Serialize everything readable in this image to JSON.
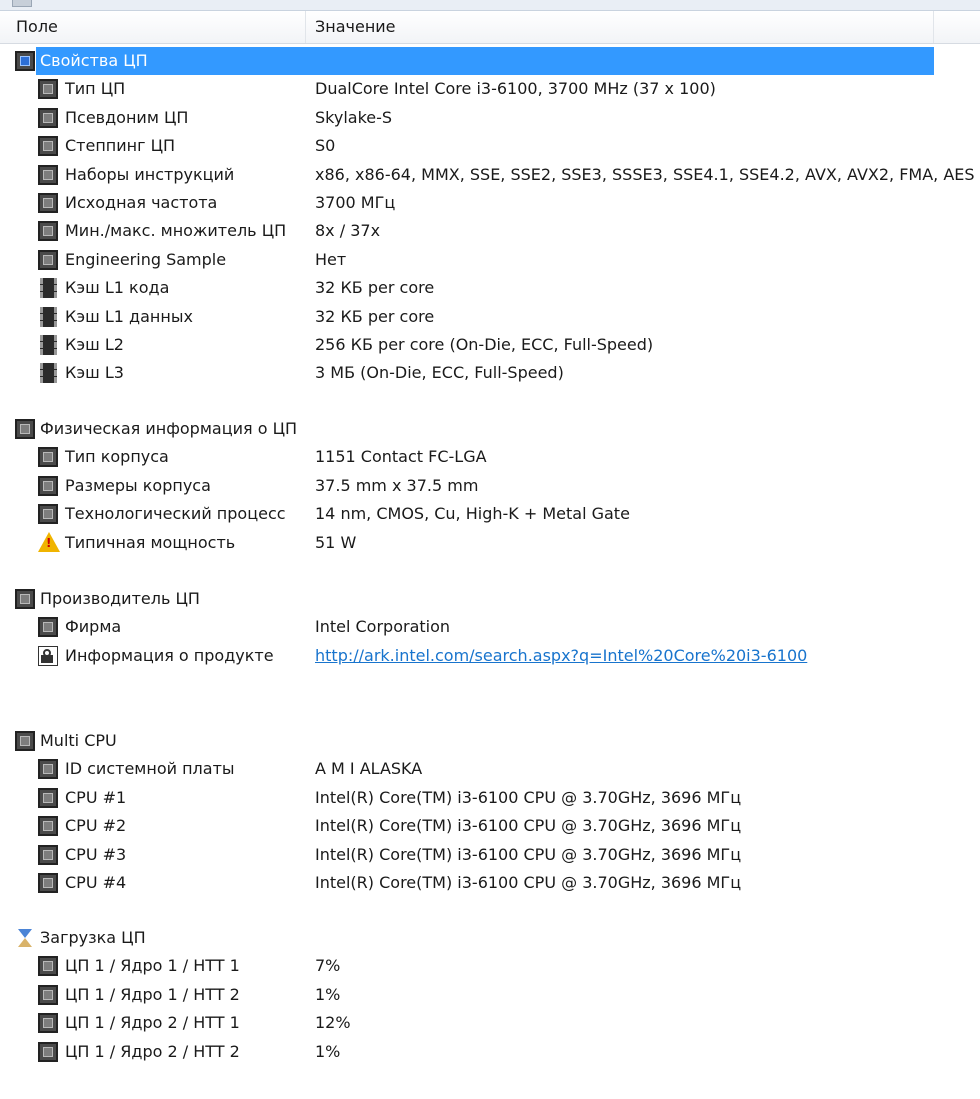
{
  "header": {
    "field": "Поле",
    "value": "Значение"
  },
  "sections": [
    {
      "title": "Свойства ЦП",
      "icon": "cpu-chip-icon",
      "selected": true,
      "items": [
        {
          "label": "Тип ЦП",
          "value": "DualCore Intel Core i3-6100, 3700 MHz (37 x 100)",
          "icon": "cpu-chip-icon"
        },
        {
          "label": "Псевдоним ЦП",
          "value": "Skylake-S",
          "icon": "cpu-chip-icon"
        },
        {
          "label": "Степпинг ЦП",
          "value": "S0",
          "icon": "cpu-chip-icon"
        },
        {
          "label": "Наборы инструкций",
          "value": "x86, x86-64, MMX, SSE, SSE2, SSE3, SSSE3, SSE4.1, SSE4.2, AVX, AVX2, FMA, AES",
          "icon": "cpu-chip-icon"
        },
        {
          "label": "Исходная частота",
          "value": "3700 МГц",
          "icon": "cpu-chip-icon"
        },
        {
          "label": "Мин./макс. множитель ЦП",
          "value": "8x / 37x",
          "icon": "cpu-chip-icon"
        },
        {
          "label": "Engineering Sample",
          "value": "Нет",
          "icon": "cpu-chip-icon"
        },
        {
          "label": "Кэш L1 кода",
          "value": "32 КБ per core",
          "icon": "cache-memory-icon"
        },
        {
          "label": "Кэш L1 данных",
          "value": "32 КБ per core",
          "icon": "cache-memory-icon"
        },
        {
          "label": "Кэш L2",
          "value": "256 КБ per core  (On-Die, ECC, Full-Speed)",
          "icon": "cache-memory-icon"
        },
        {
          "label": "Кэш L3",
          "value": "3 МБ  (On-Die, ECC, Full-Speed)",
          "icon": "cache-memory-icon"
        }
      ]
    },
    {
      "title": "Физическая информация о ЦП",
      "icon": "cpu-chip-icon",
      "items": [
        {
          "label": "Тип корпуса",
          "value": "1151 Contact FC-LGA",
          "icon": "cpu-chip-icon"
        },
        {
          "label": "Размеры корпуса",
          "value": "37.5 mm x 37.5 mm",
          "icon": "cpu-chip-icon"
        },
        {
          "label": "Технологический процесс",
          "value": "14 nm, CMOS, Cu, High-K + Metal Gate",
          "icon": "cpu-chip-icon"
        },
        {
          "label": "Типичная мощность",
          "value": "51 W",
          "icon": "warning-icon"
        }
      ]
    },
    {
      "title": "Производитель ЦП",
      "icon": "cpu-chip-icon",
      "items": [
        {
          "label": "Фирма",
          "value": "Intel Corporation",
          "icon": "cpu-chip-icon"
        },
        {
          "label": "Информация о продукте",
          "value": "http://ark.intel.com/search.aspx?q=Intel%20Core%20i3-6100",
          "icon": "link-icon",
          "link": true
        }
      ]
    },
    {
      "title": "Multi CPU",
      "icon": "cpu-chip-icon",
      "items": [
        {
          "label": "ID системной платы",
          "value": "A M I ALASKA",
          "icon": "cpu-chip-icon"
        },
        {
          "label": "CPU #1",
          "value": "Intel(R) Core(TM) i3-6100 CPU @ 3.70GHz, 3696 МГц",
          "icon": "cpu-chip-icon"
        },
        {
          "label": "CPU #2",
          "value": "Intel(R) Core(TM) i3-6100 CPU @ 3.70GHz, 3696 МГц",
          "icon": "cpu-chip-icon"
        },
        {
          "label": "CPU #3",
          "value": "Intel(R) Core(TM) i3-6100 CPU @ 3.70GHz, 3696 МГц",
          "icon": "cpu-chip-icon"
        },
        {
          "label": "CPU #4",
          "value": "Intel(R) Core(TM) i3-6100 CPU @ 3.70GHz, 3696 МГц",
          "icon": "cpu-chip-icon"
        }
      ]
    },
    {
      "title": "Загрузка ЦП",
      "icon": "hourglass-icon",
      "items": [
        {
          "label": "ЦП 1 / Ядро 1 / HTT 1",
          "value": "7%",
          "icon": "cpu-chip-icon"
        },
        {
          "label": "ЦП 1 / Ядро 1 / HTT 2",
          "value": "1%",
          "icon": "cpu-chip-icon"
        },
        {
          "label": "ЦП 1 / Ядро 2 / HTT 1",
          "value": "12%",
          "icon": "cpu-chip-icon"
        },
        {
          "label": "ЦП 1 / Ядро 2 / HTT 2",
          "value": "1%",
          "icon": "cpu-chip-icon"
        }
      ]
    }
  ],
  "colors": {
    "selection": "#3399ff",
    "link": "#1874cd"
  }
}
